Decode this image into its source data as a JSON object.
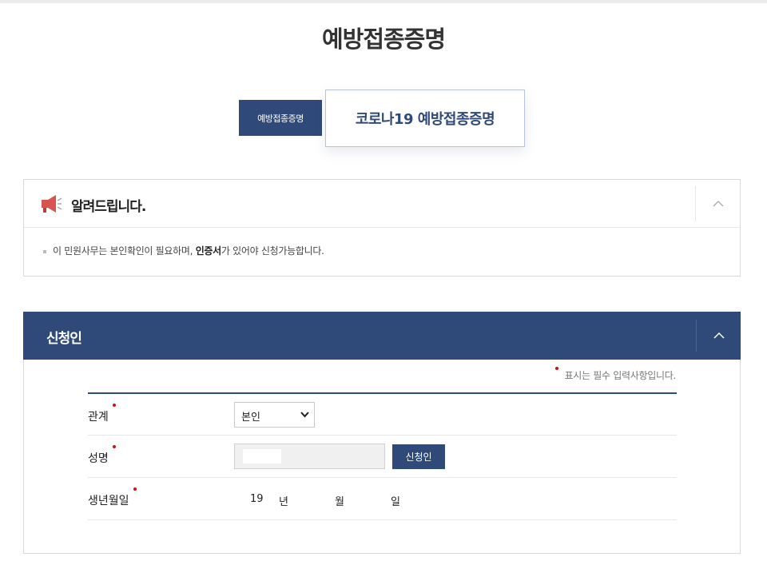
{
  "page": {
    "title": "예방접종증명"
  },
  "tabs": [
    {
      "label": "예방접종증명",
      "active": false
    },
    {
      "label": "코로나19 예방접종증명",
      "active": true
    }
  ],
  "notice": {
    "title": "알려드립니다.",
    "icon": "megaphone-icon",
    "text_before": "이 민원사무는 본인확인이 필요하며, ",
    "text_bold": "인증서",
    "text_after": "가 있어야 신청가능합니다."
  },
  "applicant": {
    "title": "신청인",
    "required_note": "표시는 필수 입력사항입니다.",
    "fields": {
      "relation_label": "관계",
      "relation_value": "본인",
      "name_label": "성명",
      "name_value": "",
      "apply_button": "신청인",
      "dob_label": "생년월일",
      "dob_year_prefix": "19",
      "dob_year_unit": "년",
      "dob_month_unit": "월",
      "dob_day_unit": "일"
    }
  },
  "colors": {
    "brand": "#2f4a78",
    "required": "#d0101a"
  }
}
